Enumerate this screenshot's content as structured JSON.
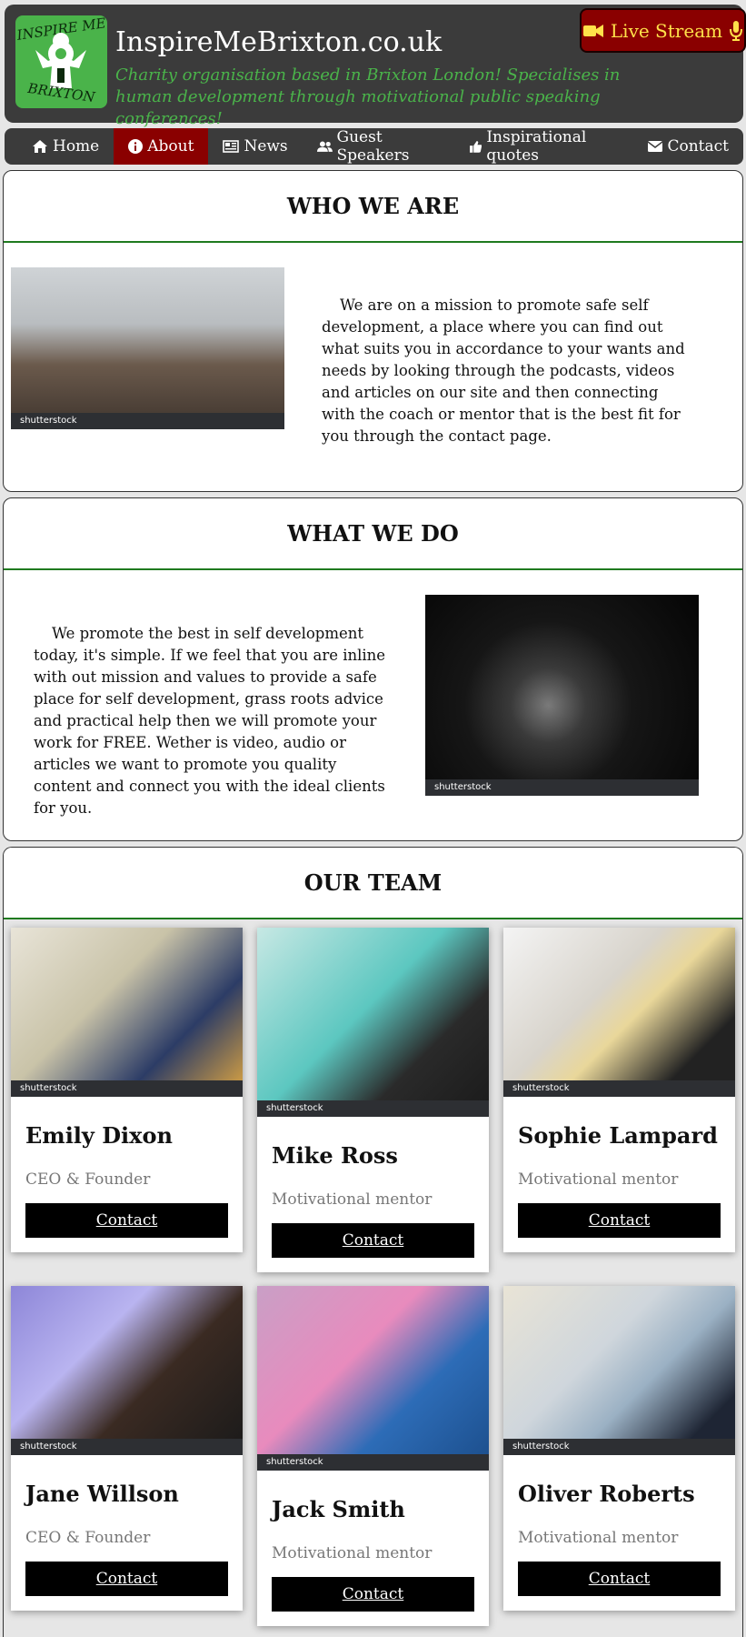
{
  "header": {
    "logo_top": "INSPIRE ME",
    "logo_bottom": "BRIXTON",
    "title": "InspireMeBrixton.co.uk",
    "tagline": "Charity organisation based in Brixton London! Specialises in human development through motivational public speaking conferences!",
    "live_stream_label": "Live Stream",
    "live_stream_icons": [
      "video-camera-icon",
      "microphone-icon"
    ]
  },
  "nav": {
    "items": [
      {
        "label": "Home",
        "icon": "home-icon"
      },
      {
        "label": "About",
        "icon": "info-icon",
        "active": true
      },
      {
        "label": "News",
        "icon": "newspaper-icon"
      },
      {
        "label": "Guest Speakers",
        "icon": "users-icon"
      },
      {
        "label": "Inspirational quotes",
        "icon": "thumbs-up-icon"
      },
      {
        "label": "Contact",
        "icon": "envelope-icon"
      }
    ]
  },
  "who": {
    "heading": "WHO WE ARE",
    "text": "We are on a mission to promote safe self development, a place where you can find out what suits you in accordance to your wants and needs by looking through the podcasts, videos and articles on our site and then connecting with the coach or mentor that is the best fit for you through the contact page.",
    "image_watermark": "shutterstock"
  },
  "what": {
    "heading": "WHAT WE DO",
    "text": "We promote the best in self development today, it's simple. If we feel that you are inline with out mission and values to provide a safe place for self development, grass roots advice and practical help then we will promote your work for FREE. Wether is video, audio or articles we want to promote you quality content and connect you with the ideal clients for you.",
    "image_watermark": "shutterstock"
  },
  "team": {
    "heading": "OUR TEAM",
    "contact_label": "Contact",
    "watermark": "shutterstock",
    "members": [
      {
        "name": "Emily Dixon",
        "role": "CEO & Founder"
      },
      {
        "name": "Mike Ross",
        "role": "Motivational mentor"
      },
      {
        "name": "Sophie Lampard",
        "role": "Motivational mentor"
      },
      {
        "name": "Jane Willson",
        "role": "CEO & Founder"
      },
      {
        "name": "Jack Smith",
        "role": "Motivational mentor"
      },
      {
        "name": "Oliver Roberts",
        "role": "Motivational mentor"
      }
    ]
  },
  "colors": {
    "header_bg": "#3b3b3b",
    "accent_green": "#4ab34a",
    "active_red": "#8a0000",
    "live_text": "#ffe14a",
    "divider_green": "#1f7a1f"
  }
}
